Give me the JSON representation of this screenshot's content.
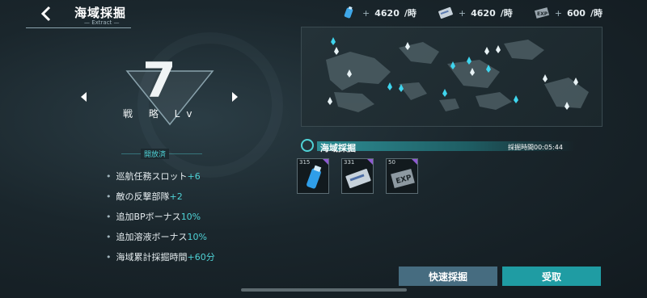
{
  "header": {
    "title": "海域採掘",
    "subtitle": "— Extract —"
  },
  "resources": [
    {
      "icon": "fuel-tank-icon",
      "plus": "+",
      "amount": "4620",
      "unit": "/時"
    },
    {
      "icon": "ticket-card-icon",
      "plus": "+",
      "amount": "4620",
      "unit": "/時"
    },
    {
      "icon": "exp-card-icon",
      "plus": "+",
      "amount": "600",
      "unit": "/時"
    }
  ],
  "level": {
    "value": "7",
    "label": "戦 略 Lv"
  },
  "unlocked": {
    "label": "開放済",
    "bonuses": [
      {
        "text": "巡航任務スロット",
        "value": "+6"
      },
      {
        "text": "敵の反撃部隊",
        "value": "+2"
      },
      {
        "text": "追加BPボーナス",
        "value": "10%"
      },
      {
        "text": "追加溶液ボーナス",
        "value": "10%"
      },
      {
        "text": "海域累計採掘時間",
        "value": "+60分"
      }
    ]
  },
  "zone": {
    "title": "海域採掘",
    "time_label": "採掘時間",
    "time_value": "00:05:44",
    "items": [
      {
        "count": "315",
        "icon": "fuel-tank-icon"
      },
      {
        "count": "331",
        "icon": "ticket-card-icon"
      },
      {
        "count": "50",
        "icon": "exp-card-icon"
      }
    ]
  },
  "buttons": {
    "quick": "快速採掘",
    "claim": "受取"
  },
  "colors": {
    "accent": "#4fd2d6",
    "claim": "#1f9ca3",
    "quick": "#466c80",
    "rarity": "#8e5bd1"
  }
}
